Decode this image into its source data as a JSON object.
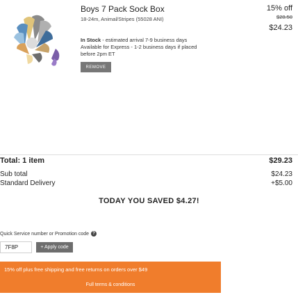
{
  "item": {
    "title": "Boys 7 Pack Sock Box",
    "details": "18-24m, Animal/Stripes (55028 ANI)",
    "stock_bold": "In Stock",
    "stock_rest": " - estimated arrival 7-9 business days",
    "express_line1": "Available for Express - 1-2 business days if placed",
    "express_line2": "before 2pm ET",
    "remove_label": "REMOVE",
    "discount_pct": "15% off",
    "old_price": "$28.50",
    "new_price": "$24.23"
  },
  "summary": {
    "total_label": "Total: 1 item",
    "total_value": "$29.23",
    "subtotal_label": "Sub total",
    "subtotal_value": "$24.23",
    "delivery_label": "Standard Delivery",
    "delivery_value": "+$5.00",
    "saved_text": "TODAY YOU SAVED $4.27!"
  },
  "promo": {
    "label": "Quick Service number or Promotion code",
    "help_icon": "?",
    "code_value": "7F8P",
    "apply_label": "+ Apply code",
    "offer_text": "15% off plus free shipping and free returns on orders over $49",
    "offer_terms": "Full terms & conditions"
  },
  "colors": {
    "offer_bg": "#f07d2c",
    "button_bg": "#6d6d6d"
  }
}
